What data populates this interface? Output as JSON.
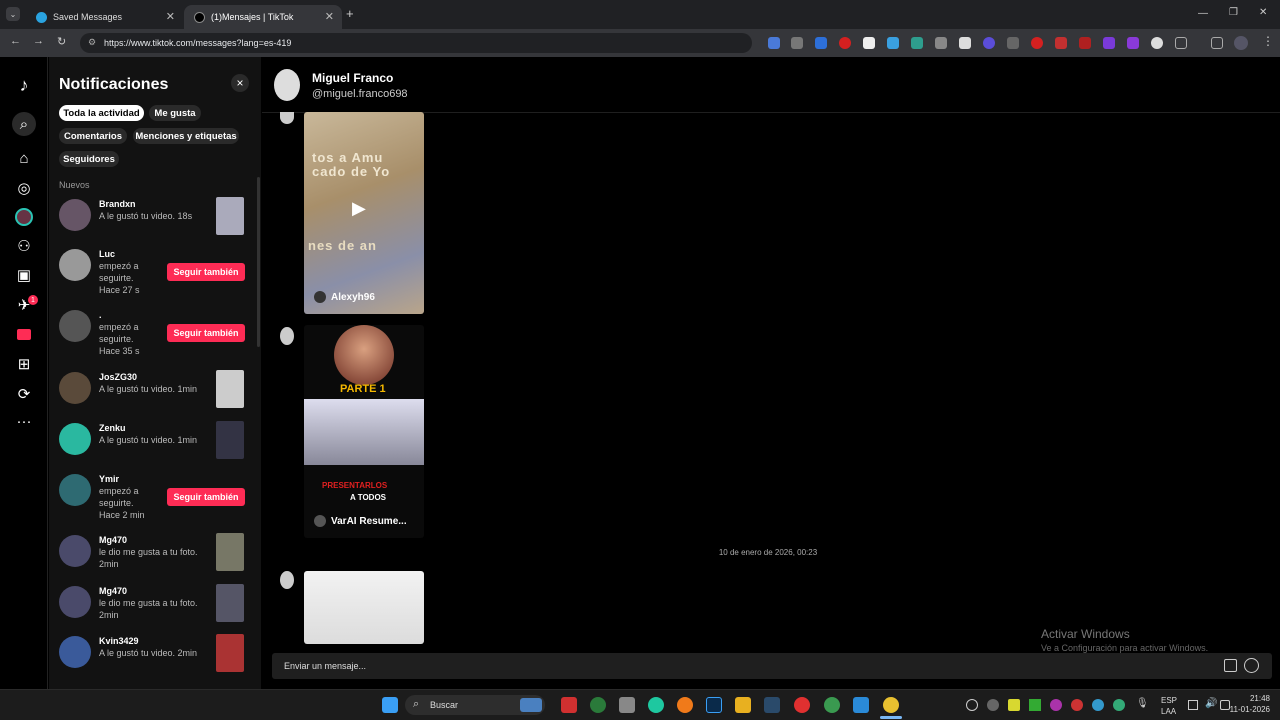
{
  "browser": {
    "tabs": [
      {
        "title": "Saved Messages",
        "active": false
      },
      {
        "title": "(1)Mensajes | TikTok",
        "active": true
      }
    ],
    "new_tab": "+",
    "url": "https://www.tiktok.com/messages?lang=es-419"
  },
  "nav": {
    "notif_badge": "1"
  },
  "notifications": {
    "title": "Notificaciones",
    "close": "×",
    "filters": [
      "Toda la actividad",
      "Me gusta",
      "Comentarios",
      "Menciones y etiquetas",
      "Seguidores"
    ],
    "section": "Nuevos",
    "items": [
      {
        "name": "Brandxn",
        "text": "A le gustó tu video. 18s",
        "action": null
      },
      {
        "name": "Luc",
        "text": "empezó a seguirte.",
        "time": "Hace 27 s",
        "action": "Seguir también"
      },
      {
        "name": ".",
        "text": "empezó a seguirte.",
        "time": "Hace 35 s",
        "action": "Seguir también"
      },
      {
        "name": "JosZG30",
        "text": "A le gustó tu video. 1min",
        "action": null
      },
      {
        "name": "Zenku",
        "text": "A le gustó tu video. 1min",
        "action": null
      },
      {
        "name": "Ymir",
        "text": "empezó a seguirte.",
        "time": "Hace 2 min",
        "action": "Seguir también"
      },
      {
        "name": "Mg470",
        "text": "le dio me gusta a tu foto.",
        "time": "2min",
        "action": null
      },
      {
        "name": "Mg470",
        "text": "le dio me gusta a tu foto.",
        "time": "2min",
        "action": null
      },
      {
        "name": "Kvin3429",
        "text": "A le gustó tu video. 2min",
        "action": null
      }
    ]
  },
  "chat": {
    "contact_name": "Miguel Franco",
    "contact_handle": "@miguel.franco698",
    "video1": {
      "overlay_lines": [
        "tos a Amu",
        "cado de Yo",
        "nes de an"
      ],
      "author": "Alexyh96"
    },
    "video2": {
      "badge": "PARTE 1",
      "caption_red": "PRESENTARLOS",
      "caption_white": "A TODOS",
      "author": "VarAI Resume..."
    },
    "timestamp": "10 de enero de 2026, 00:23",
    "input_placeholder": "Enviar un mensaje...",
    "watermark_title": "Activar Windows",
    "watermark_sub": "Ve a Configuración para activar Windows."
  },
  "taskbar": {
    "search": "Buscar",
    "lang_top": "ESP",
    "lang_bottom": "LAA",
    "time": "21:48",
    "date": "11-01-2026"
  },
  "colors": {
    "accent": "#fe2c55",
    "panel": "#121212",
    "bg": "#000000"
  }
}
